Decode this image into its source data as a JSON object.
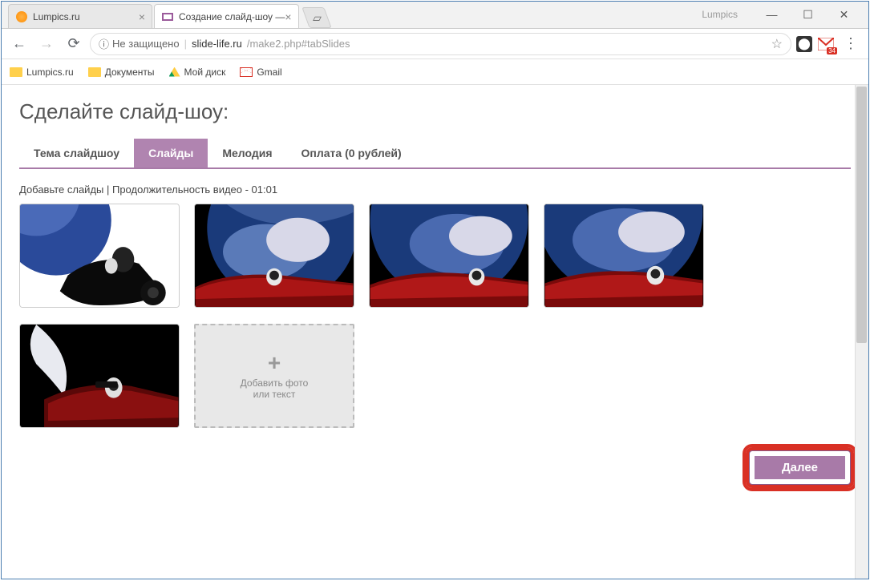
{
  "window": {
    "title": "Lumpics"
  },
  "browser": {
    "tabs": [
      {
        "title": "Lumpics.ru",
        "active": false
      },
      {
        "title": "Создание слайд-шоу —",
        "active": true
      }
    ],
    "nav": {
      "back": "←",
      "forward": "→",
      "reload": "⟳"
    },
    "address": {
      "insecure_label": "Не защищено",
      "host": "slide-life.ru",
      "path": "/make2.php#tabSlides"
    },
    "gmail_badge": "34"
  },
  "bookmarks": [
    {
      "label": "Lumpics.ru",
      "icon": "folder"
    },
    {
      "label": "Документы",
      "icon": "folder"
    },
    {
      "label": "Мой диск",
      "icon": "drive"
    },
    {
      "label": "Gmail",
      "icon": "gmail"
    }
  ],
  "page": {
    "heading": "Сделайте слайд-шоу:",
    "tabs": [
      {
        "label": "Тема слайдшоу",
        "active": false
      },
      {
        "label": "Слайды",
        "active": true
      },
      {
        "label": "Мелодия",
        "active": false
      },
      {
        "label": "Оплата (0 рублей)",
        "active": false
      }
    ],
    "slides_info": "Добавьте слайды | Продолжительность видео - 01:01",
    "add_slide": {
      "line1": "Добавить фото",
      "line2": "или текст"
    },
    "next_button": "Далее"
  }
}
